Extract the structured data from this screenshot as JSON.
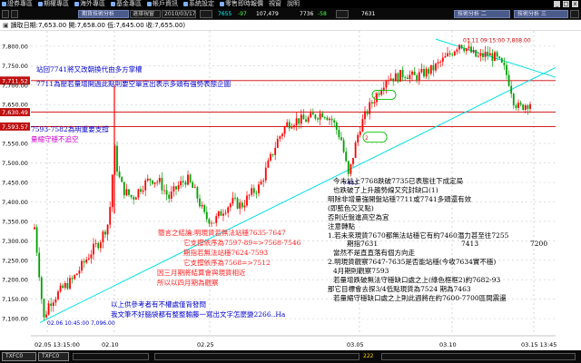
{
  "menubar": {
    "items": [
      "證券專區",
      "期權專區",
      "海外專區",
      "基金專區",
      "帳戶資訊",
      "系統設定",
      "零售即時報價",
      "視窗",
      "說明"
    ],
    "window_buttons": [
      "_",
      "□",
      "x"
    ]
  },
  "toolbar": {
    "tab_label": "期貨技術分析",
    "box1": "選擇視窗",
    "date": "2010/03/17",
    "price1": "7655",
    "change1": "-97",
    "volume": "107,479",
    "price2": "7736",
    "change2": "-58",
    "price3": "7631",
    "pill1": "技術分析 二",
    "pill2": "技術分析 三"
  },
  "infobar": {
    "text": "讀取日期:7,653.00 開:7,658.00 低:7,645.00 收:7,655.00)"
  },
  "chart": {
    "price_labels": [
      "7,800.00",
      "7,750.00",
      "7,711.52",
      "7,700.00",
      "7,650.00",
      "7,630.49",
      "7,593.57",
      "7,550.00",
      "7,500.00",
      "7,450.00",
      "7,400.00",
      "7,350.00",
      "7,300.00",
      "7,250.00",
      "7,200.00",
      "7,150.00",
      "7,100.00"
    ],
    "highlight_labels": {
      "l1": "7,711.52",
      "l2": "7,630.49",
      "l3": "7,593.57"
    },
    "date_labels": [
      "02.05 13:15:00",
      "02.10",
      "02.25",
      "03.05",
      "03.10",
      "03.15 13:45:00"
    ],
    "peak_label": "03.11 09:15:00 7,808.00",
    "low_label": "02.06 10:45:00 7,096.00",
    "mark_7463": "7463"
  },
  "annotations": {
    "a1": "站回7741將又改朝換代由多方掌權",
    "a2": "7711為壓若量增開過此點則要空單宜出表示多頭有強勢表態企圖",
    "a3": "7593-7582為明重要支撐",
    "a4": "量縮守穩不追空",
    "b1": "今未站上7768跌破7735已表態往下成定局",
    "b2": "也跌破了上升趨勢線又究封缺口(1)",
    "b3": "明除非增量強開盤站穩7711或7741多頭還有效",
    "b4": "(即藍色交叉點)",
    "b5": "否則近盤進高空為宜",
    "b6": "注意轉點",
    "b7": "1.若未來現貨7670都無法站穩它有約7460潛力甚至往7255",
    "b8": "期指7631",
    "b9": "7413",
    "b10": "7200",
    "b11": "當然不是直直落有個方向走",
    "b12": "2.明現貨觀察7647-7635是否能站穩(今收7634實不穩)",
    "b13": "4月期則觀察7593",
    "b14": "若量增跌破無法守穩缺口處之上(綠色框框2)約7682-93",
    "b15": "那它目標會去探3/4低點現貨為7524  期為7463",
    "b16": "若量縮守穩缺口處之上則此週將在約7600-7700區間震盪",
    "c1": "簡言之結論:明現貨若無法站穩7635-7647",
    "c2": "它支撐依序為7597-89=>7568-7546",
    "c3": "期指若無法站穩7624-7593",
    "c4": "它支撐依序為7568=>7512",
    "c5": "因三月期將結算會與現貨相近",
    "c6": "所以以四月期為觀察",
    "d1": "以上供參考者有不權處僅背發問",
    "d2": "我文筆不好腦袋都有整整輸藤一寫出文字怎麼變2266..Ha"
  },
  "statusbar": {
    "tab1": "TXFC0",
    "tab2": "TXFC0",
    "page_num": "222",
    "right_text": "|"
  },
  "colors": {
    "up": "#ff0000",
    "down": "#00a000",
    "trend": "#00e0e0",
    "highlight_bg": "#c01010"
  }
}
